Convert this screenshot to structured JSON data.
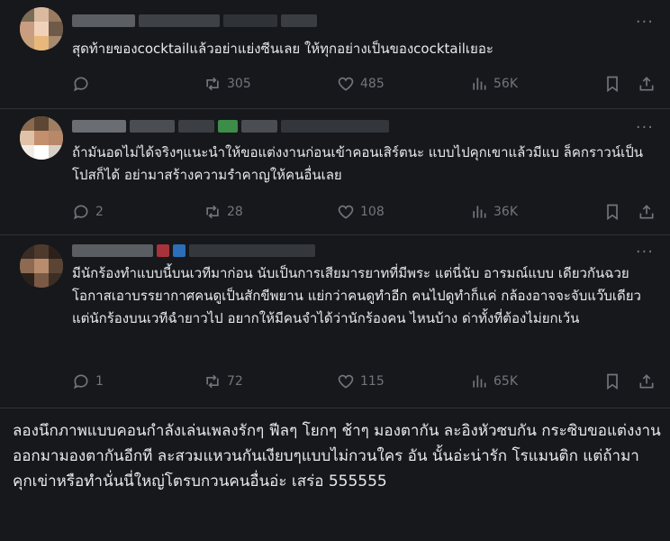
{
  "tweets": [
    {
      "text": "สุดท้ายของcocktailแล้วอย่าแย่งซีนเลย ให้ทุกอย่างเป็นของcocktailเยอะ",
      "replies": "",
      "retweets": "305",
      "likes": "485",
      "views": "56K",
      "more": "···"
    },
    {
      "text": "ถ้ามันอดไม่ได้จริงๆแนะนำให้ขอแต่งงานก่อนเข้าคอนเสิร์ตนะ แบบไปคุกเขาแล้วมีแบ ล็คกราวน์เป็นโปสก็ได้ อย่ามาสร้างความรำคาญให้คนอื่นเลย",
      "replies": "2",
      "retweets": "28",
      "likes": "108",
      "views": "36K",
      "more": "···"
    },
    {
      "text": "มีนักร้องทำแบบนี้บนเวทีมาก่อน นับเป็นการเสียมารยาทที่มีพระ แต่นี่นับ อารมณ์แบบ เดียวกันฉวยโอกาสเอาบรรยากาศคนดูเป็นสักขีพยาน แย่กว่าคนดูทำอีก คนไปดูทำก็แค่ กล้องอาจจะจับแว๊บเดียว แต่นักร้องบนเวทีฉำยาวไป อยากให้มีคนจำได้ว่านักร้องคน ไหนบ้าง ด่าทั้งที่ต้องไม่ยกเว้น",
      "replies": "1",
      "retweets": "72",
      "likes": "115",
      "views": "65K",
      "more": "···"
    }
  ],
  "footer": {
    "text": "ลองนึกภาพแบบคอนกำลังเล่นเพลงรักๆ ฟีลๆ โยกๆ ช้าๆ มองตากัน ละอิงหัวซบกัน กระซิบขอแต่งงาน ออกมามองตากันอีกที ละสวมแหวนกันเงียบๆแบบไม่กวนใคร อัน นั้นอ่ะน่ารัก โรแมนติก แต่ถ้ามาคุกเข่าหรือทำนั่นนี่ใหญ่โตรบกวนคนอื่นอ่ะ เสร่อ 555555"
  },
  "colors": {
    "background": "#16181c",
    "text": "#e7e9ea",
    "muted": "#71767b",
    "divider": "#2f3336"
  }
}
